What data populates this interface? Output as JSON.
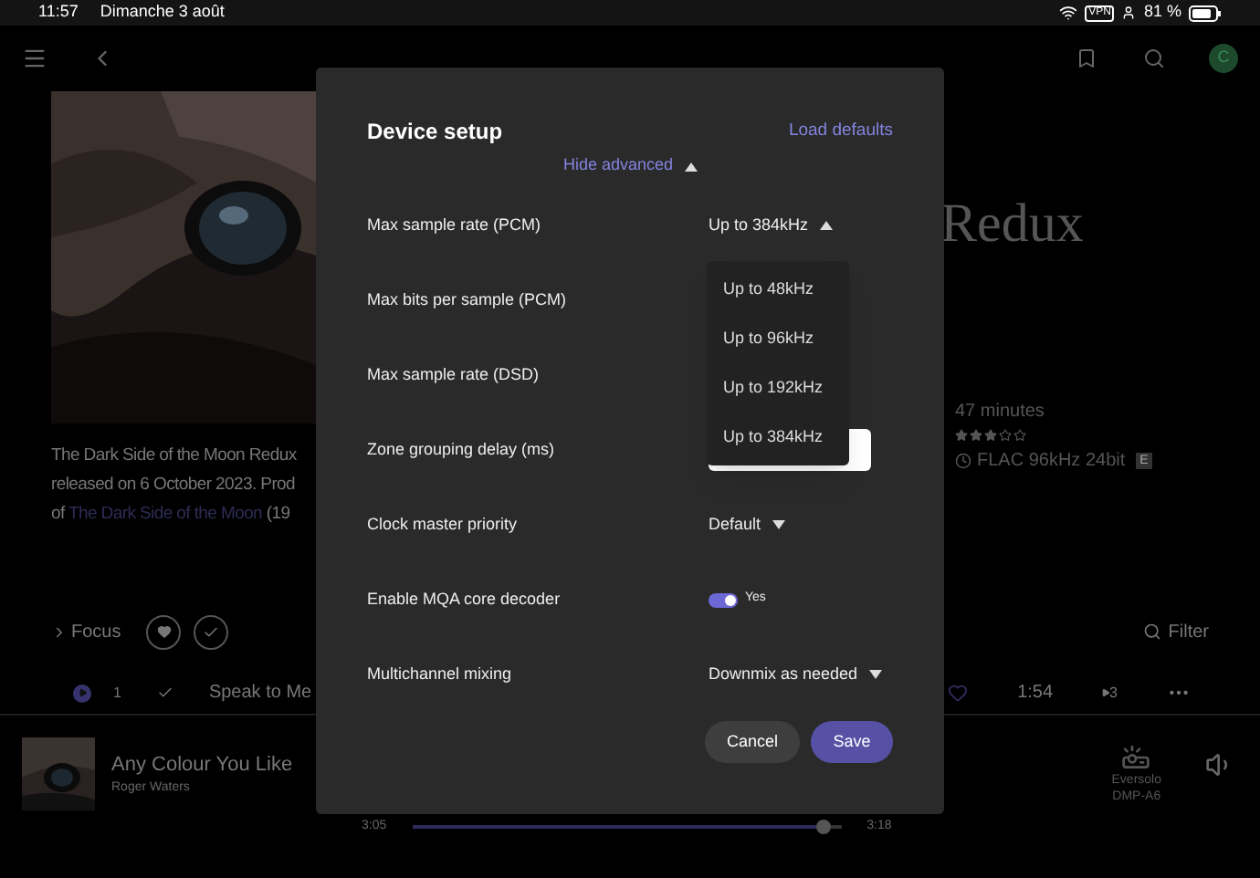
{
  "status_bar": {
    "time": "11:57",
    "date": "Dimanche 3 août",
    "vpn": "VPN",
    "battery": "81 %"
  },
  "nav": {
    "avatar": "C"
  },
  "album": {
    "title_visible": "Redux",
    "description": [
      {
        "text": "The Dark Side of the Moon Redux"
      },
      {
        "text": "released on 6 October 2023. Prod"
      },
      {
        "text": "of ",
        "link": "The Dark Side of the Moon",
        "after": " (19"
      }
    ],
    "duration": "47 minutes",
    "stars": 3,
    "format": "FLAC 96kHz 24bit",
    "badge": "E"
  },
  "toolbar": {
    "focus": "Focus",
    "filter": "Filter"
  },
  "track": {
    "number": "1",
    "title": "Speak to Me",
    "length": "1:54",
    "plays": "3"
  },
  "now_playing": {
    "title": "Any Colour You Like",
    "artist": "Roger Waters",
    "elapsed": "3:05",
    "total": "3:18",
    "level": 0.96,
    "device": [
      "Eversolo",
      "DMP-A6"
    ]
  },
  "dialog": {
    "title": "Device setup",
    "load_defaults": "Load defaults",
    "toggle_advanced": "Hide advanced",
    "advanced_expanded": true,
    "settings": [
      {
        "label": "Max sample rate (PCM)",
        "kind": "select",
        "value": "Up to 384kHz",
        "open": true
      },
      {
        "label": "Max bits per sample (PCM)",
        "kind": "hidden"
      },
      {
        "label": "Max sample rate (DSD)",
        "kind": "hidden"
      },
      {
        "label": "Zone grouping delay (ms)",
        "kind": "field"
      },
      {
        "label": "Clock master priority",
        "kind": "select",
        "value": "Default",
        "open": false
      },
      {
        "label": "Enable MQA core decoder",
        "kind": "toggle",
        "on": true,
        "value": "Yes"
      },
      {
        "label": "Multichannel mixing",
        "kind": "select",
        "value": "Downmix as needed",
        "open": false
      }
    ],
    "menu": [
      "Up to 48kHz",
      "Up to 96kHz",
      "Up to 192kHz",
      "Up to 384kHz"
    ],
    "buttons": [
      "Cancel",
      "Save"
    ]
  }
}
